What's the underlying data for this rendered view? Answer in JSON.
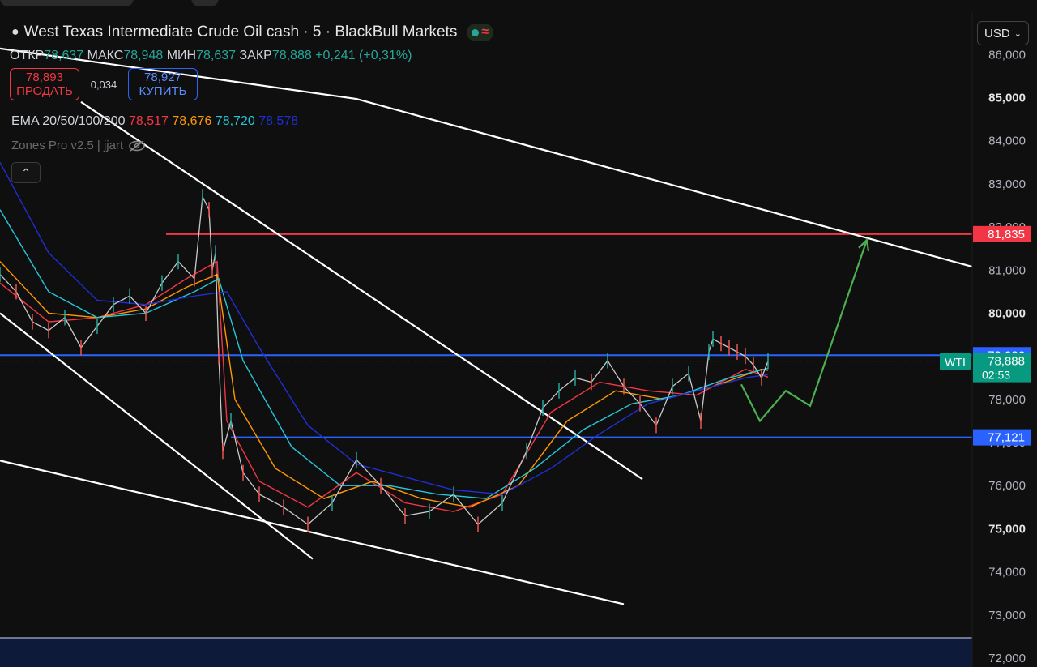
{
  "header": {
    "title": "West Texas Intermediate Crude Oil cash · 5 · BlackBull Markets",
    "status_icon": "wave-icon"
  },
  "ohlc": {
    "open_label": "ОТКР",
    "open": "78,637",
    "high_label": "МАКС",
    "high": "78,948",
    "low_label": "МИН",
    "low": "78,637",
    "close_label": "ЗАКР",
    "close": "78,888",
    "change": "+0,241 (+0,31%)"
  },
  "trade": {
    "sell_price": "78,893",
    "sell_label": "ПРОДАТЬ",
    "spread": "0,034",
    "buy_price": "78,927",
    "buy_label": "КУПИТЬ"
  },
  "ema": {
    "label": "EMA 20/50/100/200",
    "values": [
      "78,517",
      "78,676",
      "78,720",
      "78,578"
    ],
    "colors": [
      "#f23645",
      "#ff9800",
      "#26c6da",
      "#1e2fd6"
    ]
  },
  "indicator": {
    "label": "Zones Pro v2.5 | jjart"
  },
  "currency": {
    "label": "USD"
  },
  "chart_data": {
    "type": "line",
    "title": "West Texas Intermediate Crude Oil cash · 5 · BlackBull Markets",
    "ylim": [
      72000,
      86250
    ],
    "y_ticks": [
      "86,000",
      "85,000",
      "84,000",
      "83,000",
      "82,000",
      "81,000",
      "80,000",
      "79,000",
      "78,000",
      "77,000",
      "76,000",
      "75,000",
      "74,000",
      "73,000",
      "72,000"
    ],
    "y_tick_values": [
      86000,
      85000,
      84000,
      83000,
      82000,
      81000,
      80000,
      79000,
      78000,
      77000,
      76000,
      75000,
      74000,
      73000,
      72000
    ],
    "y_tick_bold": [
      false,
      true,
      false,
      false,
      false,
      false,
      true,
      false,
      false,
      false,
      false,
      true,
      false,
      false,
      false
    ],
    "grid": false,
    "price_series": {
      "x": [
        0,
        20,
        40,
        60,
        80,
        100,
        120,
        140,
        160,
        180,
        200,
        220,
        240,
        250,
        258,
        262,
        266,
        270,
        275,
        285,
        300,
        320,
        350,
        380,
        410,
        440,
        470,
        500,
        530,
        560,
        590,
        620,
        650,
        670,
        690,
        710,
        730,
        750,
        770,
        790,
        810,
        830,
        850,
        865,
        875,
        880,
        890,
        900,
        910,
        920,
        930,
        940,
        948
      ],
      "values": [
        80900,
        80500,
        79800,
        79600,
        79900,
        79200,
        79700,
        80200,
        80400,
        80000,
        80700,
        81200,
        80800,
        82700,
        82400,
        81000,
        81400,
        79000,
        76800,
        77500,
        76300,
        75800,
        75500,
        75100,
        75600,
        76600,
        76000,
        75300,
        75400,
        75800,
        75100,
        75600,
        76800,
        77800,
        78200,
        78500,
        78400,
        78900,
        78300,
        77900,
        77400,
        78300,
        78600,
        77500,
        79100,
        79400,
        79300,
        79200,
        79100,
        79000,
        78800,
        78500,
        78888
      ]
    },
    "ema_series": [
      {
        "name": "EMA 20",
        "color": "#f23645",
        "x": [
          0,
          60,
          120,
          180,
          230,
          268,
          280,
          320,
          380,
          440,
          500,
          560,
          620,
          680,
          740,
          800,
          860,
          920,
          948
        ],
        "values": [
          80700,
          79800,
          79900,
          80200,
          80800,
          81200,
          77500,
          76100,
          75500,
          76300,
          75600,
          75400,
          75800,
          77700,
          78400,
          78200,
          78100,
          78700,
          78517
        ]
      },
      {
        "name": "EMA 50",
        "color": "#ff9800",
        "x": [
          0,
          60,
          120,
          180,
          230,
          268,
          290,
          340,
          400,
          460,
          520,
          580,
          640,
          700,
          760,
          820,
          880,
          940,
          948
        ],
        "values": [
          81200,
          80000,
          79900,
          80100,
          80600,
          80900,
          78000,
          76400,
          75700,
          76100,
          75700,
          75500,
          76000,
          77500,
          78200,
          78000,
          78300,
          78700,
          78676
        ]
      },
      {
        "name": "EMA 100",
        "color": "#26c6da",
        "x": [
          0,
          60,
          120,
          180,
          240,
          270,
          300,
          360,
          420,
          480,
          540,
          600,
          660,
          720,
          780,
          840,
          900,
          948
        ],
        "values": [
          82400,
          80500,
          79900,
          80000,
          80500,
          80800,
          78900,
          76900,
          76000,
          76000,
          75800,
          75700,
          76400,
          77300,
          77900,
          78100,
          78500,
          78720
        ]
      },
      {
        "name": "EMA 200",
        "color": "#1e2fd6",
        "x": [
          0,
          60,
          120,
          180,
          240,
          280,
          320,
          380,
          440,
          500,
          560,
          620,
          680,
          740,
          800,
          860,
          920,
          948
        ],
        "values": [
          83500,
          81400,
          80300,
          80200,
          80400,
          80500,
          79200,
          77400,
          76500,
          76200,
          75900,
          75800,
          76400,
          77200,
          77900,
          78200,
          78500,
          78578
        ]
      }
    ],
    "horizontal_levels": [
      {
        "value": 81835,
        "label": "81,835",
        "color": "#f23645",
        "x_start": 205
      },
      {
        "value": 79026,
        "label": "79,026",
        "color": "#2962ff",
        "x_start": 0
      },
      {
        "value": 77121,
        "label": "77,121",
        "color": "#2962ff",
        "x_start": 285
      }
    ],
    "current_price": {
      "value": 78888,
      "label": "78,888",
      "symbol": "WTI",
      "countdown": "02:53",
      "color": "#089981"
    },
    "trendlines": [
      {
        "color": "#ffffff",
        "points": [
          [
            0,
            86140
          ],
          [
            440,
            84970
          ],
          [
            1200,
            81080
          ]
        ]
      },
      {
        "color": "#ffffff",
        "points": [
          [
            100,
            84900
          ],
          [
            793,
            76150
          ]
        ]
      },
      {
        "color": "#ffffff",
        "points": [
          [
            0,
            80000
          ],
          [
            386,
            74300
          ]
        ]
      },
      {
        "color": "#ffffff",
        "points": [
          [
            0,
            76580
          ],
          [
            770,
            73250
          ]
        ]
      }
    ],
    "projection": {
      "color": "#4caf50",
      "points": [
        [
          915,
          78350
        ],
        [
          938,
          77500
        ],
        [
          970,
          78200
        ],
        [
          1000,
          77850
        ],
        [
          1070,
          81700
        ]
      ]
    }
  }
}
